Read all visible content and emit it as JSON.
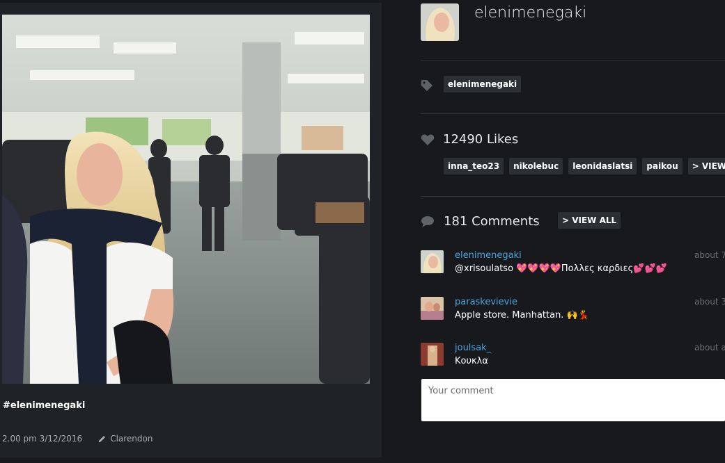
{
  "post": {
    "caption": "#elenimenegaki",
    "time": "2.00 pm 3/12/2016",
    "filter": "Clarendon"
  },
  "profile": {
    "username": "elenimenegaki"
  },
  "tags": [
    "elenimenegaki"
  ],
  "likes": {
    "label": "12490 Likes",
    "users": [
      "inna_teo23",
      "nikolebuc",
      "leonidaslatsi",
      "paikou"
    ],
    "view_all": "> VIEW ALL"
  },
  "comments": {
    "label": "181 Comments",
    "view_all": "> VIEW ALL",
    "items": [
      {
        "user": "elenimenegaki",
        "time": "about 7",
        "text": "@xrisoulatso 💖💖💖💖Πολλες καρδιες💕💕💕"
      },
      {
        "user": "paraskevievie",
        "time": "about 3",
        "text": "Apple store. Manhattan. 🙌💃"
      },
      {
        "user": "joulsak_",
        "time": "about a",
        "text": "Κουκλα"
      }
    ],
    "input_placeholder": "Your comment"
  },
  "colors": {
    "background": "#17191d",
    "panel": "#1f2226",
    "chip": "#2c2f34",
    "link": "#4ea4dc"
  },
  "icons": [
    "tag-icon",
    "heart-icon",
    "comment-icon",
    "pencil-icon"
  ]
}
